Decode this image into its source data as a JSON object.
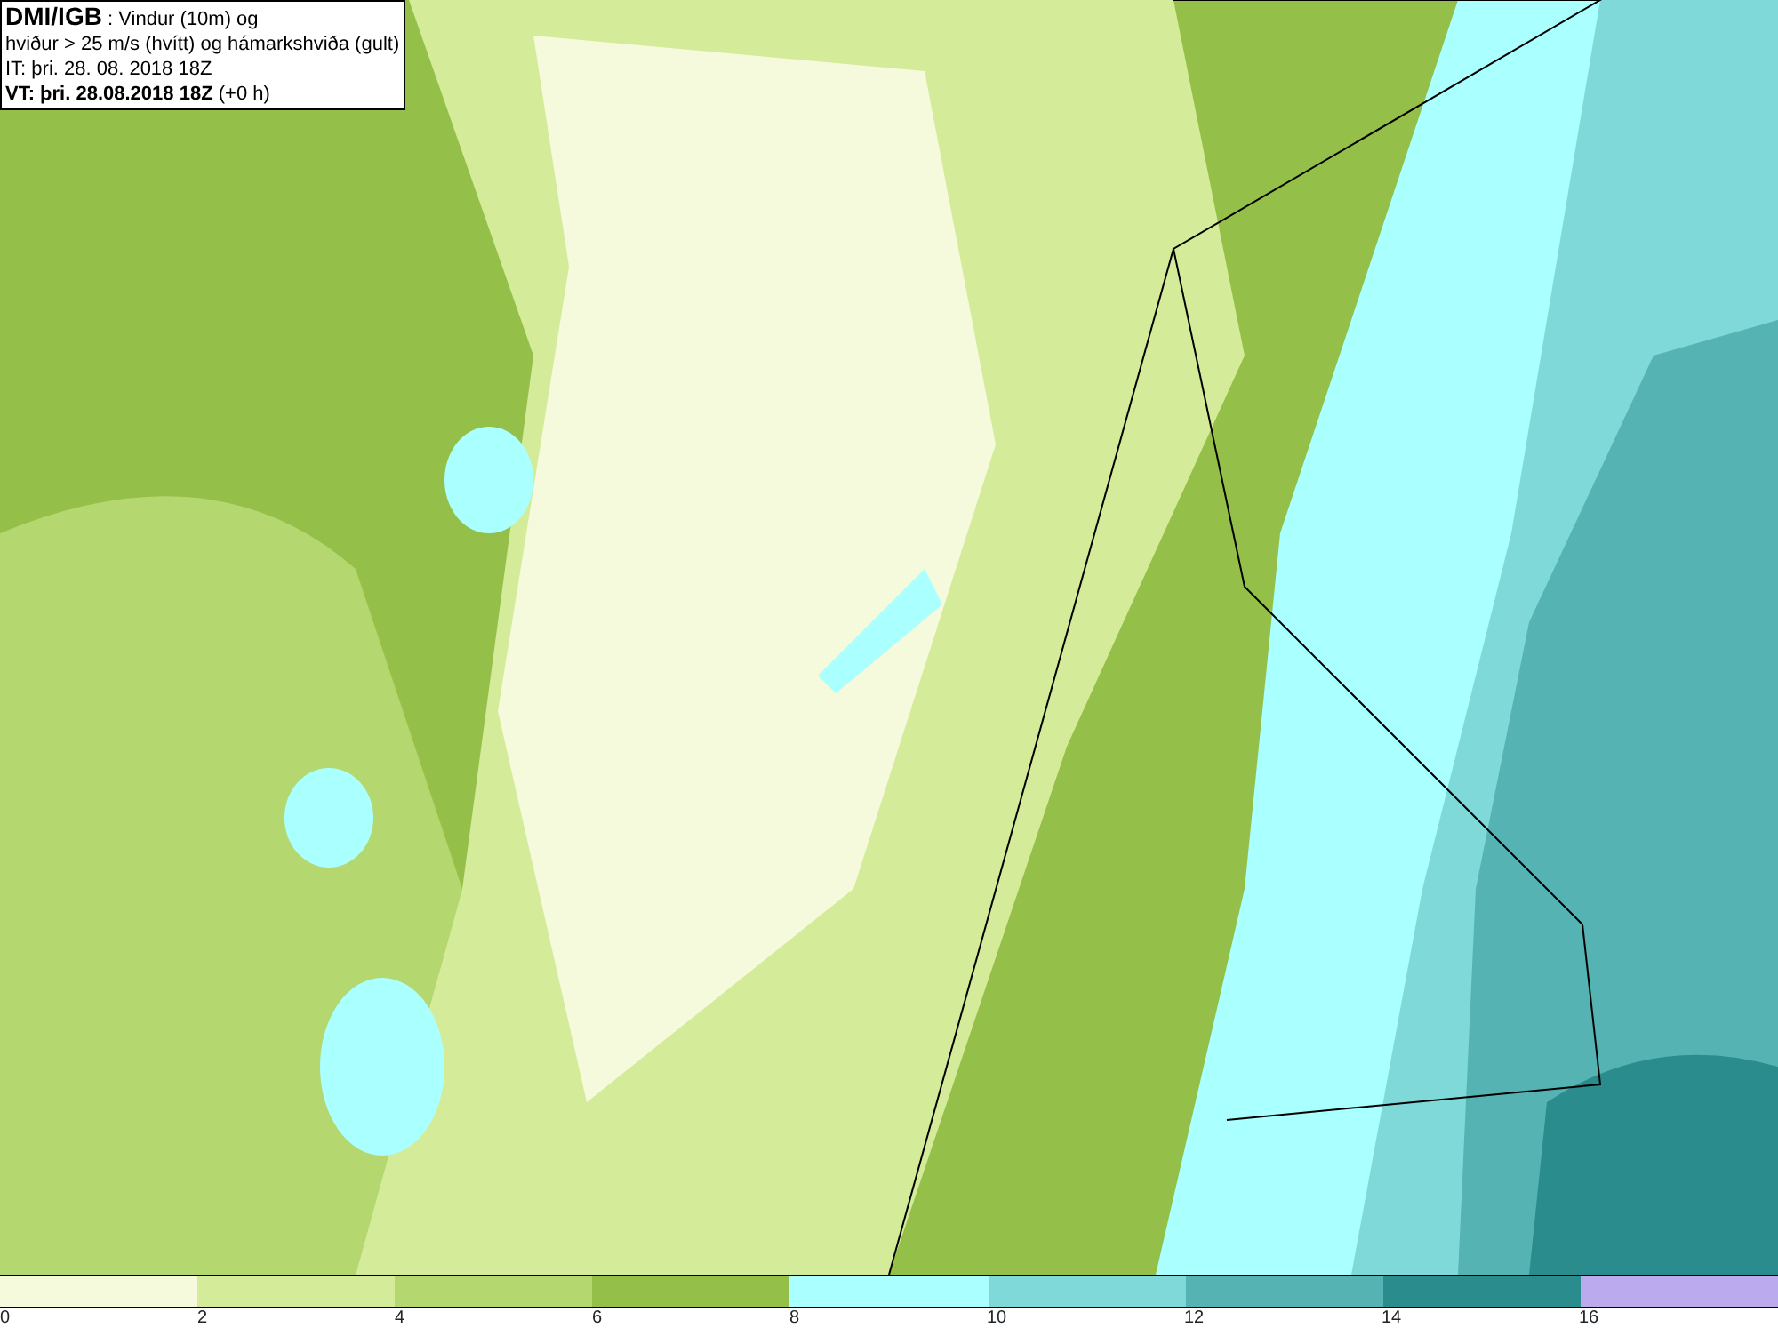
{
  "title_box": {
    "lines": [
      "**DMI/IGB** : Vindur (10m) og",
      "hviður > 25 m/s (hvítt) og hámarkshviða (gult)",
      "IT: þri. 28. 08. 2018 18Z",
      "**VT: þri. 28.08.2018 18Z** (+0 h)"
    ]
  },
  "legend": {
    "bins": [
      {
        "color": "#f5fadc"
      },
      {
        "color": "#d4eb9a"
      },
      {
        "color": "#b5d770"
      },
      {
        "color": "#94bf48"
      },
      {
        "color": "#aaffff"
      },
      {
        "color": "#7fd9d9"
      },
      {
        "color": "#55b3b3"
      },
      {
        "color": "#2a8c8c"
      },
      {
        "color": "#bbaaee"
      }
    ],
    "ticks": [
      "0",
      "2",
      "4",
      "6",
      "8",
      "10",
      "12",
      "14",
      "16"
    ]
  }
}
